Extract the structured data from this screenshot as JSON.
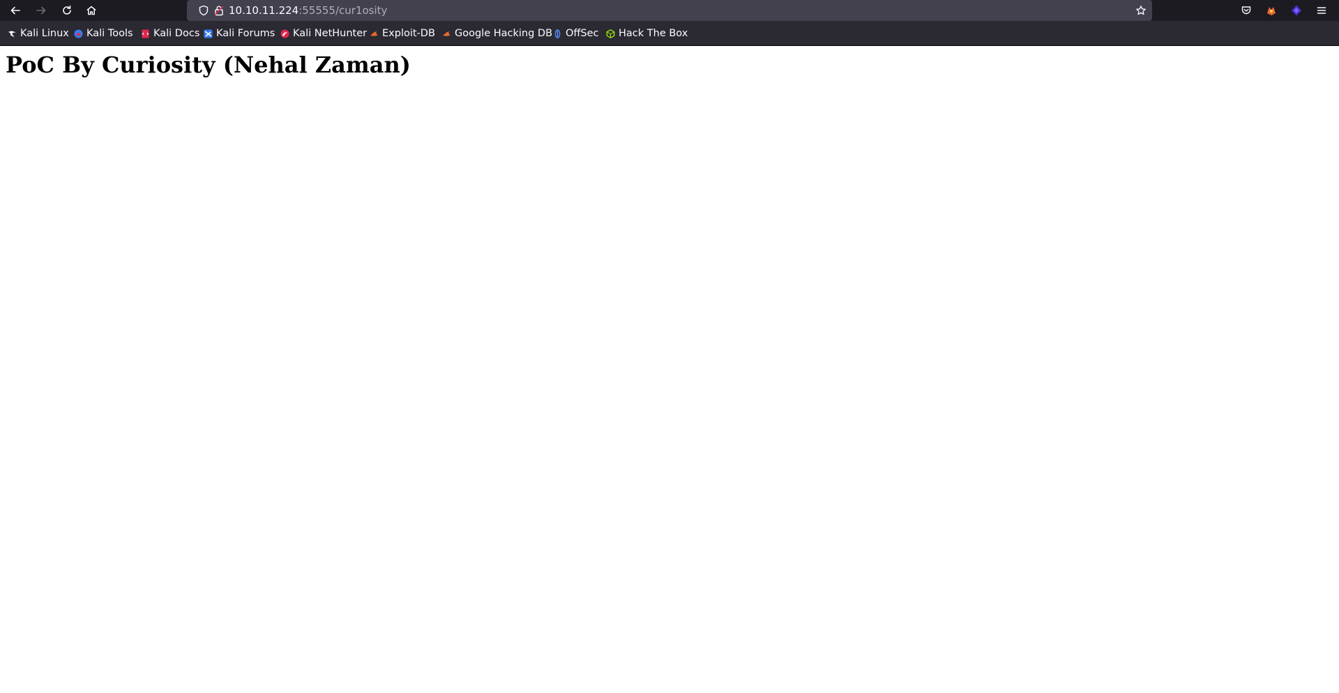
{
  "browser": {
    "url_host": "10.10.11.224",
    "url_rest": ":55555/cur1osity",
    "nav": [
      "back-icon",
      "forward-icon",
      "reload-icon",
      "home-icon"
    ],
    "toolbar_right": [
      "pocket-icon",
      "foxyproxy-icon",
      "extension-icon",
      "menu-icon"
    ]
  },
  "bookmarks": [
    {
      "label": "Kali Linux",
      "icon": "kali-dragon-icon"
    },
    {
      "label": "Kali Tools",
      "icon": "kali-tools-icon"
    },
    {
      "label": "Kali Docs",
      "icon": "kali-docs-icon"
    },
    {
      "label": "Kali Forums",
      "icon": "kali-forums-icon"
    },
    {
      "label": "Kali NetHunter",
      "icon": "kali-nethunter-icon"
    },
    {
      "label": "Exploit-DB",
      "icon": "exploit-db-icon"
    },
    {
      "label": "Google Hacking DB",
      "icon": "ghdb-icon"
    },
    {
      "label": "OffSec",
      "icon": "offsec-icon"
    },
    {
      "label": "Hack The Box",
      "icon": "htb-icon"
    }
  ],
  "page": {
    "heading": "PoC By Curiosity (Nehal Zaman)"
  },
  "colors": {
    "toolbar_bg": "#1c1b22",
    "bookmarks_bg": "#2b2a33",
    "urlbar_bg": "#42414d",
    "page_bg": "#ffffff"
  }
}
